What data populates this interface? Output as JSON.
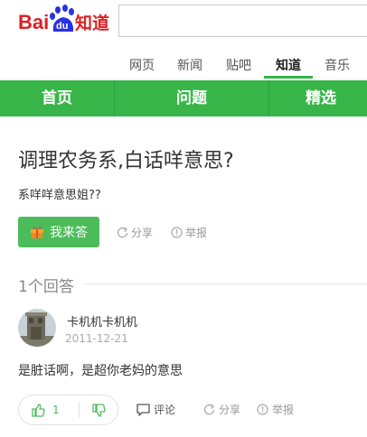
{
  "header": {
    "logo_text": "Bai",
    "logo_paw_text": "du",
    "logo_suffix": "知道",
    "search_value": ""
  },
  "channels": [
    {
      "label": "网页"
    },
    {
      "label": "新闻"
    },
    {
      "label": "贴吧"
    },
    {
      "label": "知道"
    },
    {
      "label": "音乐"
    }
  ],
  "menu": [
    {
      "label": "首页"
    },
    {
      "label": "问题"
    },
    {
      "label": "精选"
    }
  ],
  "question": {
    "title": "调理农务系,白话咩意思?",
    "description": "系咩咩意思姐??",
    "answer_button": "我来答",
    "share": "分享",
    "report": "举报"
  },
  "answers": {
    "count_label": "1个回答",
    "items": [
      {
        "user": "卡机机卡机机",
        "date": "2011-12-21",
        "text": "是脏话啊，是超你老妈的意思",
        "likes": "1",
        "comment": "评论",
        "share": "分享",
        "report": "举报"
      }
    ]
  },
  "colors": {
    "brand_green": "#38b548",
    "baidu_red": "#de1f23",
    "baidu_blue": "#2932e1"
  }
}
